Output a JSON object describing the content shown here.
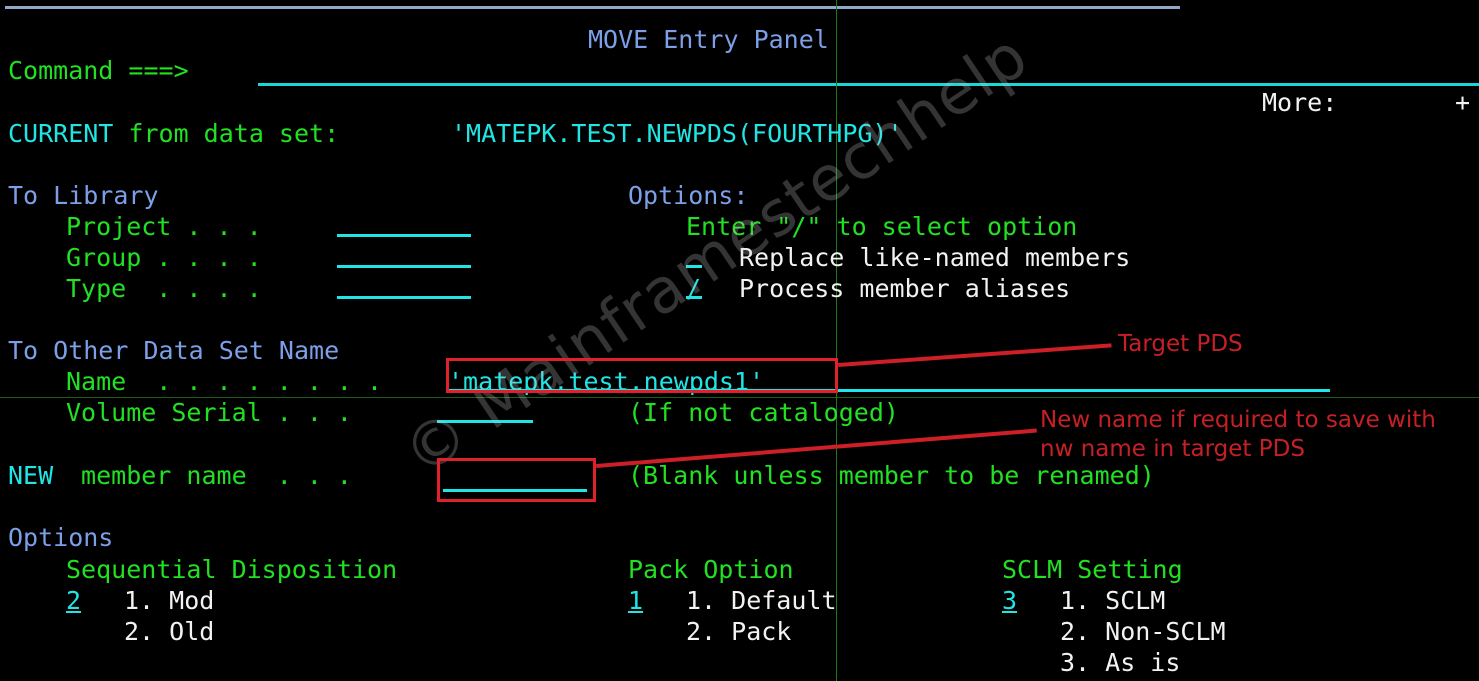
{
  "screen": {
    "title": "MOVE Entry Panel",
    "command_label": "Command ===>",
    "command_value": "",
    "more_label": "More:",
    "more_indicator": "+",
    "current_label": "CURRENT from data set:",
    "current_value": "'MATEPK.TEST.NEWPDS(FOURTHPG)'"
  },
  "to_library": {
    "heading": "To Library",
    "fields": [
      {
        "label": "Project . . .",
        "value": ""
      },
      {
        "label": "Group . . . .",
        "value": ""
      },
      {
        "label": "Type  . . . .",
        "value": ""
      }
    ]
  },
  "options_panel": {
    "heading": "Options:",
    "hint": "Enter \"/\" to select option",
    "items": [
      {
        "selector": "_",
        "label": "Replace like-named members",
        "selected": ""
      },
      {
        "selector": "/",
        "label": "Process member aliases",
        "selected": "/"
      }
    ]
  },
  "to_other": {
    "heading": "To Other Data Set Name",
    "name_label": "Name  . . . . . . . .",
    "name_value": "'matepk.test.newpds1'",
    "volume_label": "Volume Serial . . .",
    "volume_value": "",
    "volume_note": "(If not cataloged)"
  },
  "new_member": {
    "label_accent": "NEW",
    "label_rest": " member name  . . .",
    "value": "",
    "note": "(Blank unless member to be renamed)"
  },
  "options_bottom": {
    "heading": "Options",
    "groups": [
      {
        "title": "Sequential Disposition",
        "selected": "2",
        "choices": [
          "1. Mod",
          "2. Old"
        ]
      },
      {
        "title": "Pack Option",
        "selected": "1",
        "choices": [
          "1. Default",
          "2. Pack"
        ]
      },
      {
        "title": "SCLM Setting",
        "selected": "3",
        "choices": [
          "1. SCLM",
          "2. Non-SCLM",
          "3. As is"
        ]
      }
    ]
  },
  "annotations": [
    {
      "text": "Target PDS"
    },
    {
      "line1": "New name if required to save with",
      "line2": "nw name in target PDS"
    }
  ],
  "watermark": {
    "text": "© Mainframestechhelp"
  },
  "colors": {
    "background": "#000000",
    "green": "#22e022",
    "cyan": "#21e5e5",
    "light_blue": "#7d9fe8",
    "white": "#f2f2f2",
    "annotation_red": "#c62026"
  }
}
